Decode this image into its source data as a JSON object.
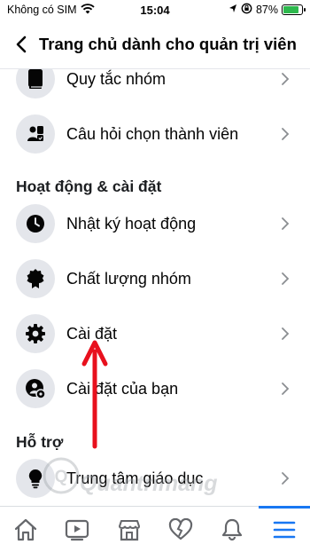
{
  "status_bar": {
    "carrier": "Không có SIM",
    "time": "15:04",
    "battery": "87%",
    "battery_level": 0.87
  },
  "header": {
    "title": "Trang chủ dành cho quản trị viên"
  },
  "menu": {
    "items_top": [
      {
        "label": "Quy tắc nhóm",
        "icon": "book-icon"
      },
      {
        "label": "Câu hỏi chọn thành viên",
        "icon": "member-question-icon"
      }
    ],
    "section_activity": "Hoạt động & cài đặt",
    "items_activity": [
      {
        "label": "Nhật ký hoạt động",
        "icon": "clock-icon"
      },
      {
        "label": "Chất lượng nhóm",
        "icon": "badge-icon"
      },
      {
        "label": "Cài đặt",
        "icon": "gear-icon"
      },
      {
        "label": "Cài đặt của bạn",
        "icon": "user-gear-icon"
      }
    ],
    "section_support": "Hỗ trợ",
    "items_support": [
      {
        "label": "Trung tâm giáo dục",
        "icon": "lightbulb-icon"
      }
    ]
  },
  "tabbar": {
    "tabs": [
      "home-icon",
      "video-icon",
      "marketplace-icon",
      "dating-icon",
      "bell-icon",
      "menu-icon"
    ],
    "active": "menu-icon"
  },
  "watermark": "Quantrimang",
  "colors": {
    "accent": "#1877f2",
    "icon_bg": "#e4e6eb",
    "arrow": "#e8101d"
  }
}
